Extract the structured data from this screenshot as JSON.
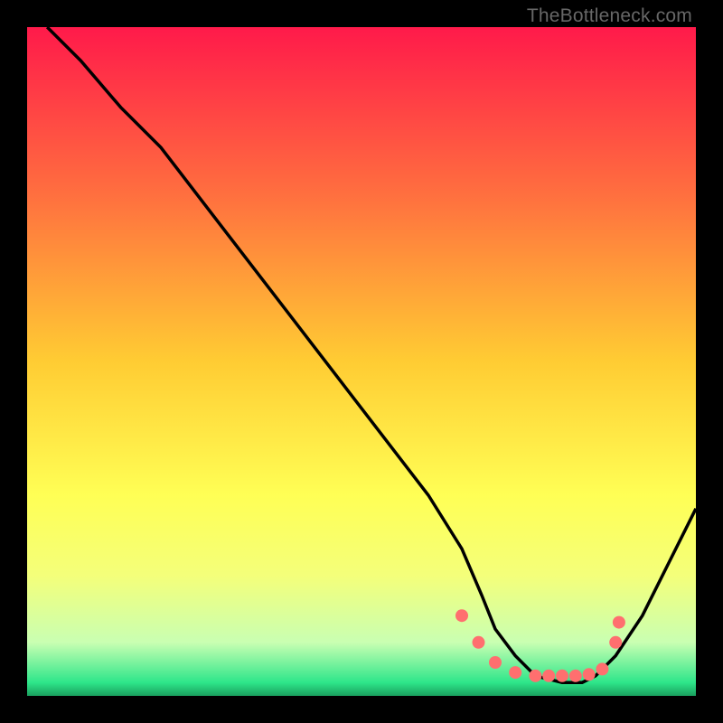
{
  "watermark": "TheBottleneck.com",
  "chart_data": {
    "type": "line",
    "title": "",
    "xlabel": "",
    "ylabel": "",
    "xlim": [
      0,
      100
    ],
    "ylim": [
      0,
      100
    ],
    "gradient_stops": [
      {
        "offset": 0,
        "color": "#ff1a4a"
      },
      {
        "offset": 0.25,
        "color": "#ff6f3f"
      },
      {
        "offset": 0.5,
        "color": "#ffcc33"
      },
      {
        "offset": 0.7,
        "color": "#ffff55"
      },
      {
        "offset": 0.82,
        "color": "#f4ff7a"
      },
      {
        "offset": 0.92,
        "color": "#c9ffb2"
      },
      {
        "offset": 0.98,
        "color": "#2ee68a"
      },
      {
        "offset": 1.0,
        "color": "#1aa05e"
      }
    ],
    "series": [
      {
        "name": "bottleneck-curve",
        "x": [
          3,
          8,
          14,
          20,
          30,
          40,
          50,
          60,
          65,
          68,
          70,
          73,
          76,
          80,
          83,
          85,
          88,
          92,
          96,
          100
        ],
        "y": [
          100,
          95,
          88,
          82,
          69,
          56,
          43,
          30,
          22,
          15,
          10,
          6,
          3,
          2,
          2,
          3,
          6,
          12,
          20,
          28
        ]
      }
    ],
    "markers": {
      "name": "highlight-points",
      "color": "#ff6f6f",
      "radius": 7,
      "x": [
        65,
        67.5,
        70,
        73,
        76,
        78,
        80,
        82,
        84,
        86,
        88,
        88.5
      ],
      "y": [
        12,
        8,
        5,
        3.5,
        3,
        3,
        3,
        3,
        3.2,
        4,
        8,
        11
      ]
    }
  }
}
